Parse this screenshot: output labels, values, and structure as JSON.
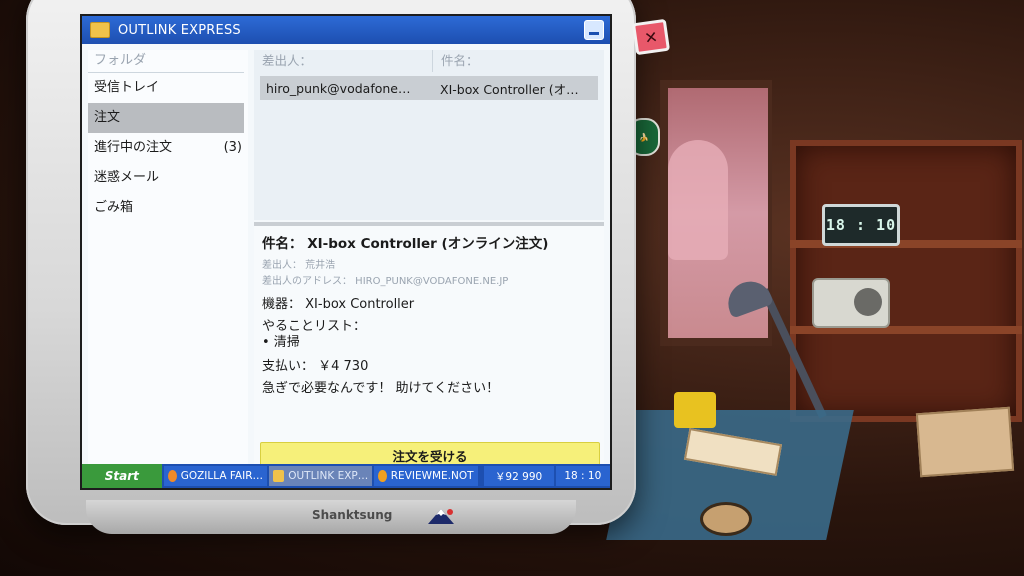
{
  "window": {
    "title": "OUTLINK EXPRESS"
  },
  "sidebar": {
    "header": "フォルダ",
    "items": [
      {
        "label": "受信トレイ",
        "count": ""
      },
      {
        "label": "注文",
        "count": ""
      },
      {
        "label": "進行中の注文",
        "count": "(3)"
      },
      {
        "label": "迷惑メール",
        "count": ""
      },
      {
        "label": "ごみ箱",
        "count": ""
      }
    ],
    "active_index": 1
  },
  "list": {
    "col_sender": "差出人：",
    "col_subject": "件名：",
    "rows": [
      {
        "sender": "hiro_punk@vodafone…",
        "subject": "XI-box Controller (オ…"
      }
    ]
  },
  "message": {
    "subject": "件名： XI-box Controller (オンライン注文)",
    "sender": "差出人： 荒井浩",
    "address": "差出人のアドレス： HIRO_PUNK@VODAFONE.NE.JP",
    "device": "機器： XI-box Controller",
    "todo_label": "やることリスト：",
    "todo_item": "• 清掃",
    "payment": "支払い： ￥4 730",
    "plea": "急ぎで必要なんです！ 助けてください！",
    "accept_button": "注文を受ける"
  },
  "taskbar": {
    "start": "Start",
    "tasks": [
      {
        "label": "GOZILLA FAIR…",
        "icon_color": "#f08a2a"
      },
      {
        "label": "OUTLINK EXP…",
        "icon_color": "#f0c24a"
      },
      {
        "label": "REVIEWME.NOT",
        "icon_color": "#f0a020"
      }
    ],
    "money": "￥92 990",
    "clock": "18 : 10"
  },
  "scene": {
    "desk_clock": "18 : 10",
    "monitor_brand": "Shanktsung"
  }
}
